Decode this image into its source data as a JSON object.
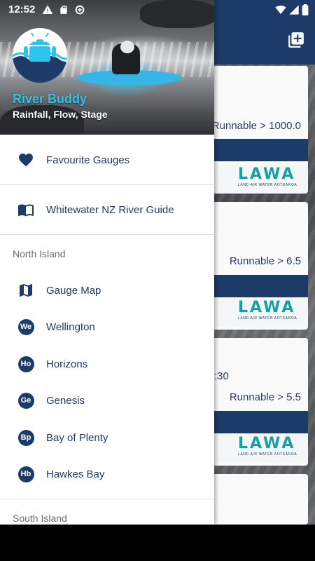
{
  "status_bar": {
    "time": "12:52"
  },
  "drawer": {
    "app_name": "River Buddy",
    "tagline": "Rainfall, Flow, Stage",
    "top_items": [
      {
        "label": "Favourite Gauges",
        "icon": "heart-icon"
      },
      {
        "label": "Whitewater NZ River Guide",
        "icon": "book-icon"
      }
    ],
    "sections": [
      {
        "title": "North Island",
        "items": [
          {
            "label": "Gauge Map",
            "icon": "map-icon"
          },
          {
            "label": "Wellington",
            "badge": "We"
          },
          {
            "label": "Horizons",
            "badge": "Ho"
          },
          {
            "label": "Genesis",
            "badge": "Ge"
          },
          {
            "label": "Bay of Plenty",
            "badge": "Bp"
          },
          {
            "label": "Hawkes Bay",
            "badge": "Hb"
          }
        ]
      },
      {
        "title": "South Island",
        "items": []
      }
    ]
  },
  "background": {
    "cards": [
      {
        "runnable": "Runnable > 1000.0"
      },
      {
        "runnable": "Runnable > 6.5"
      },
      {
        "time": ":30",
        "runnable": "Runnable > 5.5"
      }
    ],
    "lawa_logo": {
      "word": "LAWA",
      "sub": "LAND AIR WATER AOTEAROA"
    }
  },
  "colors": {
    "primary": "#1d3b68",
    "accent": "#2ec3ee",
    "lawa": "#14a0a4"
  }
}
